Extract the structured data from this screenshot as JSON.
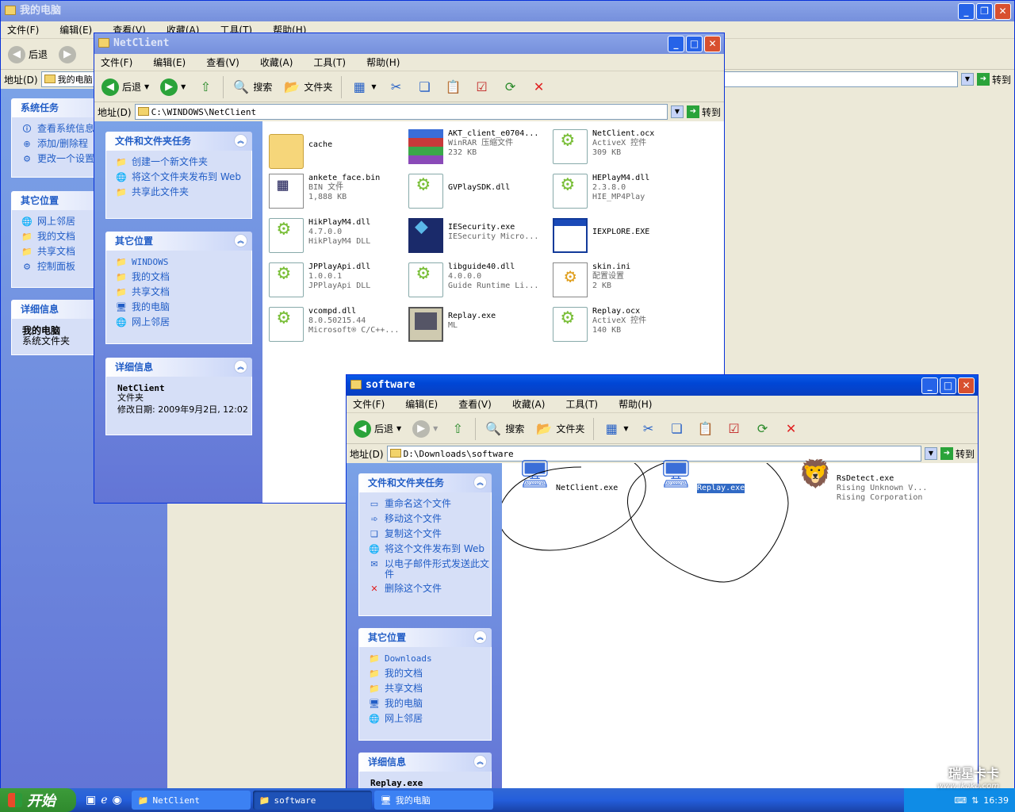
{
  "taskbar": {
    "start": "开始",
    "buttons": [
      {
        "label": "NetClient"
      },
      {
        "label": "software"
      },
      {
        "label": "我的电脑"
      }
    ],
    "clock": "16:39",
    "watermark": "瑞星卡卡",
    "watermark_url": "www.ikaka.com"
  },
  "mycomputer": {
    "title": "我的电脑",
    "menu": [
      "文件(F)",
      "编辑(E)",
      "查看(V)",
      "收藏(A)",
      "工具(T)",
      "帮助(H)"
    ],
    "back": "后退",
    "address_label": "地址(D)",
    "address": "我的电脑",
    "go": "转到",
    "system_tasks": {
      "title": "系统任务",
      "items": [
        "查看系统信息",
        "添加/删除程",
        "更改一个设置"
      ]
    },
    "other_places": {
      "title": "其它位置",
      "items": [
        "网上邻居",
        "我的文档",
        "共享文档",
        "控制面板"
      ]
    },
    "details": {
      "title": "详细信息",
      "name": "我的电脑",
      "type": "系统文件夹"
    }
  },
  "netclient": {
    "title": "NetClient",
    "menu": [
      "文件(F)",
      "编辑(E)",
      "查看(V)",
      "收藏(A)",
      "工具(T)",
      "帮助(H)"
    ],
    "toolbar": {
      "back": "后退",
      "search": "搜索",
      "folders": "文件夹"
    },
    "address_label": "地址(D)",
    "address": "C:\\WINDOWS\\NetClient",
    "go": "转到",
    "tasks": {
      "title": "文件和文件夹任务",
      "items": [
        "创建一个新文件夹",
        "将这个文件夹发布到 Web",
        "共享此文件夹"
      ]
    },
    "other_places": {
      "title": "其它位置",
      "items": [
        "WINDOWS",
        "我的文档",
        "共享文档",
        "我的电脑",
        "网上邻居"
      ]
    },
    "details": {
      "title": "详细信息",
      "name": "NetClient",
      "type": "文件夹",
      "modified": "修改日期: 2009年9月2日, 12:02"
    },
    "files": [
      {
        "name": "cache",
        "l2": "",
        "l3": "",
        "icon": "folder-icon"
      },
      {
        "name": "AKT_client_e0704...",
        "l2": "WinRAR 压缩文件",
        "l3": "232 KB",
        "icon": "winrar-icon"
      },
      {
        "name": "NetClient.ocx",
        "l2": "ActiveX 控件",
        "l3": "309 KB",
        "icon": "activex-icon"
      },
      {
        "name": "ankete_face.bin",
        "l2": "BIN 文件",
        "l3": "1,888 KB",
        "icon": "bin-file-icon"
      },
      {
        "name": "GVPlaySDK.dll",
        "l2": "",
        "l3": "",
        "icon": "dll-icon"
      },
      {
        "name": "HEPlayM4.dll",
        "l2": "2.3.8.0",
        "l3": "HIE_MP4Play",
        "icon": "dll-icon"
      },
      {
        "name": "HikPlayM4.dll",
        "l2": "4.7.0.0",
        "l3": "HikPlayM4 DLL",
        "icon": "dll-icon"
      },
      {
        "name": "IESecurity.exe",
        "l2": "IESecurity Micro...",
        "l3": "",
        "icon": "cube-exe-icon"
      },
      {
        "name": "IEXPLORE.EXE",
        "l2": "",
        "l3": "",
        "icon": "window-exe-icon"
      },
      {
        "name": "JPPlayApi.dll",
        "l2": "1.0.0.1",
        "l3": "JPPlayApi DLL",
        "icon": "dll-icon"
      },
      {
        "name": "libguide40.dll",
        "l2": "4.0.0.0",
        "l3": "Guide Runtime Li...",
        "icon": "dll-icon"
      },
      {
        "name": "skin.ini",
        "l2": "配置设置",
        "l3": "2 KB",
        "icon": "ini-icon"
      },
      {
        "name": "vcompd.dll",
        "l2": "8.0.50215.44",
        "l3": "Microsoft® C/C++...",
        "icon": "dll-icon"
      },
      {
        "name": "Replay.exe",
        "l2": "ML",
        "l3": "",
        "icon": "monitor-exe-icon"
      },
      {
        "name": "Replay.ocx",
        "l2": "ActiveX 控件",
        "l3": "140 KB",
        "icon": "activex-icon"
      }
    ]
  },
  "software": {
    "title": "software",
    "menu": [
      "文件(F)",
      "编辑(E)",
      "查看(V)",
      "收藏(A)",
      "工具(T)",
      "帮助(H)"
    ],
    "toolbar": {
      "back": "后退",
      "search": "搜索",
      "folders": "文件夹"
    },
    "address_label": "地址(D)",
    "address": "D:\\Downloads\\software",
    "go": "转到",
    "tasks": {
      "title": "文件和文件夹任务",
      "items": [
        "重命名这个文件",
        "移动这个文件",
        "复制这个文件",
        "将这个文件发布到 Web",
        "以电子邮件形式发送此文件",
        "删除这个文件"
      ]
    },
    "other_places": {
      "title": "其它位置",
      "items": [
        "Downloads",
        "我的文档",
        "共享文档",
        "我的电脑",
        "网上邻居"
      ]
    },
    "details": {
      "title": "详细信息",
      "name": "Replay.exe"
    },
    "files": [
      {
        "name": "NetClient.exe",
        "l2": "",
        "l3": "",
        "icon": "computer-exe-icon"
      },
      {
        "name": "Replay.exe",
        "l2": "",
        "l3": "",
        "icon": "computer-exe-icon",
        "selected": true
      },
      {
        "name": "RsDetect.exe",
        "l2": "Rising Unknown V...",
        "l3": "Rising Corporation",
        "icon": "lion-icon"
      }
    ]
  }
}
